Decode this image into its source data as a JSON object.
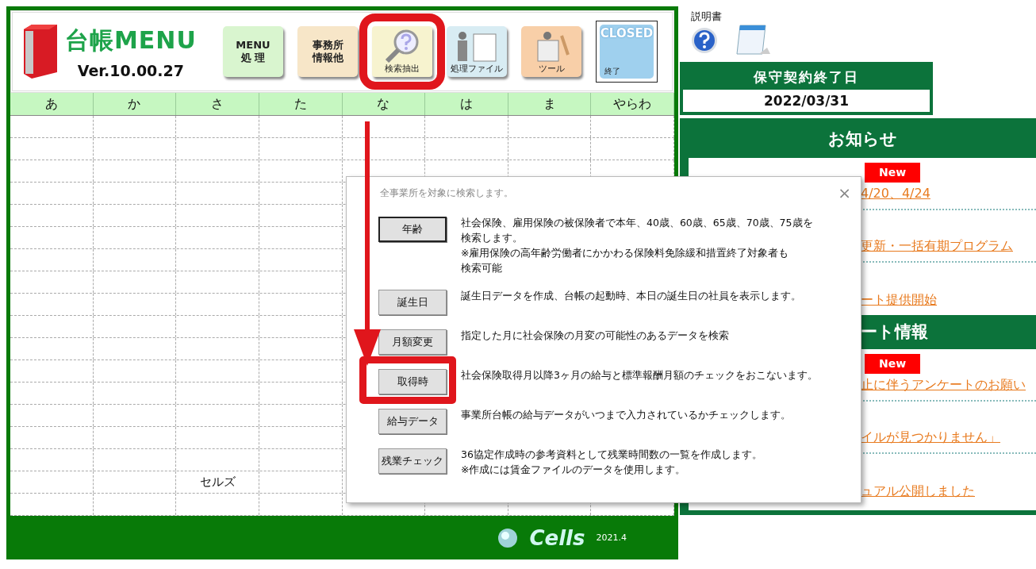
{
  "app": {
    "title": "台帳MENU",
    "version": "Ver.10.00.27"
  },
  "toolbar": [
    {
      "kind": "menu",
      "lines": [
        "MENU",
        "処 理"
      ],
      "highlighted": false
    },
    {
      "kind": "office",
      "lines": [
        "事務所",
        "情報他"
      ],
      "highlighted": false
    },
    {
      "kind": "search",
      "lines": [
        "検索抽出"
      ],
      "highlighted": true
    },
    {
      "kind": "binder",
      "lines": [
        "処理ファイル"
      ],
      "highlighted": false
    },
    {
      "kind": "tool",
      "lines": [
        "ツール"
      ],
      "highlighted": false
    },
    {
      "kind": "closed",
      "lines": [
        "CLOSED",
        "終了"
      ],
      "highlighted": false
    }
  ],
  "grid": {
    "columns": [
      "あ",
      "か",
      "さ",
      "た",
      "な",
      "は",
      "ま",
      "やらわ"
    ],
    "name_entry": "セルズ"
  },
  "footer": {
    "brand": "Cells",
    "year": "2021.4"
  },
  "manual": {
    "label": "説明書"
  },
  "maintenance": {
    "title": "保守契約終了日",
    "date": "2022/03/31"
  },
  "news": {
    "title": "お知らせ",
    "items": [
      {
        "kind": "link",
        "badge": "New",
        "text": "4/20、4/24"
      },
      {
        "kind": "link",
        "text": "更新・一括有期プログラム"
      },
      {
        "kind": "link",
        "text": "ート提供開始"
      },
      {
        "kind": "header",
        "text": "ート情報"
      },
      {
        "kind": "link",
        "badge": "New",
        "text": "止に伴うアンケートのお願い"
      },
      {
        "kind": "link",
        "text": "イルが見つかりません」"
      },
      {
        "kind": "link",
        "text": "ュアル公開しました"
      }
    ]
  },
  "dialog": {
    "title": "全事業所を対象に検索します。",
    "close": "×",
    "options": [
      {
        "button": "年齢",
        "lines": [
          "社会保険、雇用保険の被保険者で本年、40歳、60歳、65歳、70歳、75歳を",
          "検索します。",
          "※雇用保険の高年齢労働者にかかわる保険料免除緩和措置終了対象者も",
          "検索可能"
        ],
        "focused": true,
        "highlighted": false
      },
      {
        "button": "誕生日",
        "lines": [
          "誕生日データを作成、台帳の起動時、本日の誕生日の社員を表示します。"
        ],
        "focused": false,
        "highlighted": false
      },
      {
        "button": "月額変更",
        "lines": [
          "指定した月に社会保険の月変の可能性のあるデータを検索"
        ],
        "focused": false,
        "highlighted": false
      },
      {
        "button": "取得時",
        "lines": [
          "社会保険取得月以降3ヶ月の給与と標準報酬月額のチェックをおこないます。"
        ],
        "focused": false,
        "highlighted": true
      },
      {
        "button": "給与データ",
        "lines": [
          "事業所台帳の給与データがいつまで入力されているかチェックします。"
        ],
        "focused": false,
        "highlighted": false
      },
      {
        "button": "残業チェック",
        "lines": [
          "36協定作成時の参考資料として残業時間数の一覧を作成します。",
          "※作成には賃金ファイルのデータを使用します。"
        ],
        "focused": false,
        "highlighted": false
      }
    ]
  }
}
